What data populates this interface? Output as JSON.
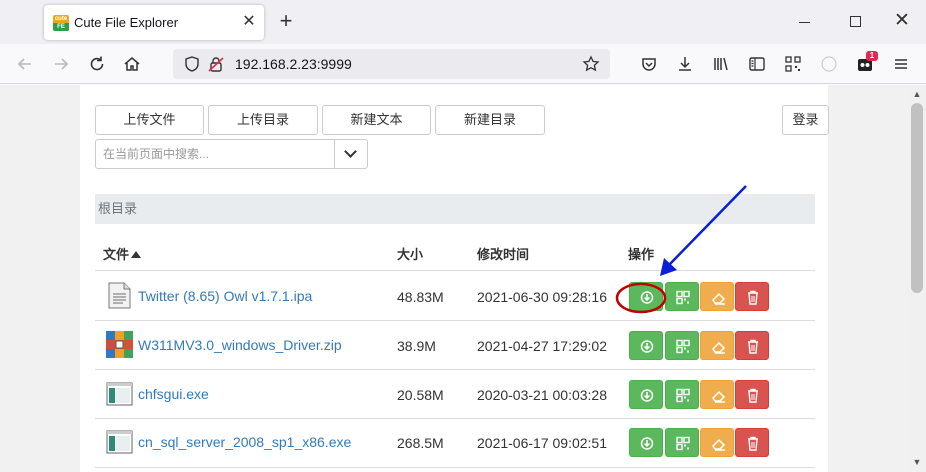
{
  "browser": {
    "tab_title": "Cute File Explorer",
    "favicon_text_top": "cute",
    "favicon_text_bottom": "FE",
    "tab_close": "✕",
    "new_tab": "+",
    "url": "192.168.2.23:9999",
    "notification_count": "1",
    "window_close": "✕"
  },
  "toolbar": {
    "upload_file": "上传文件",
    "upload_dir": "上传目录",
    "new_text": "新建文本",
    "new_dir": "新建目录",
    "login": "登录",
    "search_placeholder": "在当前页面中搜索..."
  },
  "breadcrumb": "根目录",
  "table": {
    "headers": {
      "name": "文件",
      "size": "大小",
      "mtime": "修改时间",
      "actions": "操作"
    },
    "sort": "name-ascending",
    "rows": [
      {
        "name": "Twitter (8.65) Owl v1.7.1.ipa",
        "size": "48.83M",
        "mtime": "2021-06-30 09:28:16",
        "icon": "document-icon"
      },
      {
        "name": "W311MV3.0_windows_Driver.zip",
        "size": "38.9M",
        "mtime": "2021-04-27 17:29:02",
        "icon": "archive-icon"
      },
      {
        "name": "chfsgui.exe",
        "size": "20.58M",
        "mtime": "2020-03-21 00:03:28",
        "icon": "executable-icon"
      },
      {
        "name": "cn_sql_server_2008_sp1_x86.exe",
        "size": "268.5M",
        "mtime": "2021-06-17 09:02:51",
        "icon": "executable-icon"
      }
    ]
  },
  "colors": {
    "link": "#337ab7",
    "success": "#5cb85c",
    "warning": "#f0ad4e",
    "danger": "#d9534f",
    "annotation_arrow": "#0a1fd6",
    "annotation_circle": "#c00000"
  }
}
